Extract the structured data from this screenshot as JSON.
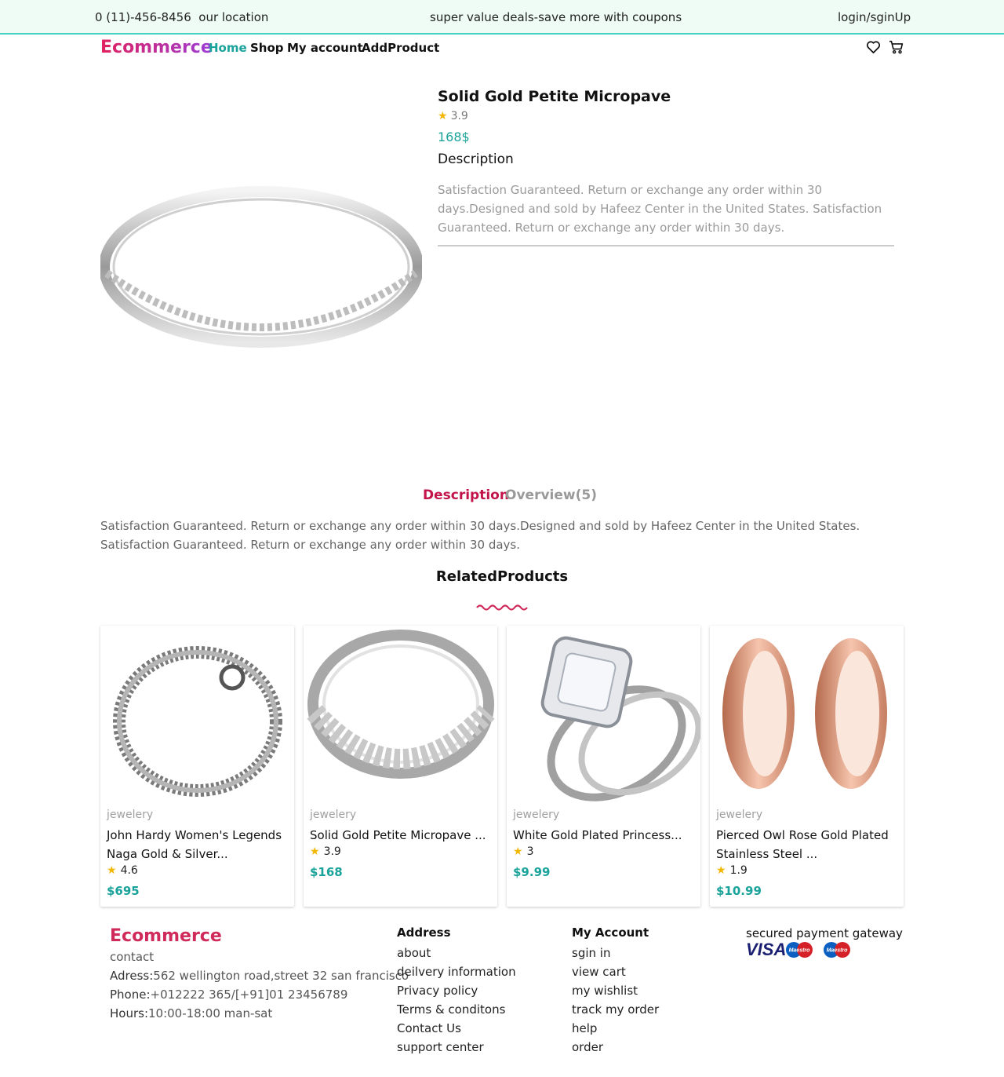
{
  "topbar": {
    "phone_location": "0 (11)-456-8456  our location",
    "deals": "super value deals-save more with coupons",
    "login": "login/sginUp"
  },
  "nav": {
    "brand": "Ecommerce",
    "links": [
      "Home",
      "Shop",
      "My account",
      "AddProduct"
    ],
    "icons": [
      "heart-icon",
      "cart-icon"
    ]
  },
  "product": {
    "title": "Solid Gold Petite Micropave",
    "rating": "3.9",
    "price": "168$",
    "description_heading": "Description",
    "description": "Satisfaction Guaranteed. Return or exchange any order within 30 days.Designed and sold by Hafeez Center in the United States. Satisfaction Guaranteed. Return or exchange any order within 30 days."
  },
  "tabs": {
    "items": [
      "Description",
      "Overview(5)"
    ],
    "active": "Description",
    "content": "Satisfaction Guaranteed. Return or exchange any order within 30 days.Designed and sold by Hafeez Center in the United States. Satisfaction Guaranteed. Return or exchange any order within 30 days."
  },
  "related": {
    "title": "RelatedProducts",
    "products": [
      {
        "category": "jewelery",
        "name": "John Hardy Women's Legends Naga Gold & Silver...",
        "rating": "4.6",
        "price": "$695"
      },
      {
        "category": "jewelery",
        "name": "Solid Gold Petite Micropave ...",
        "rating": "3.9",
        "price": "$168"
      },
      {
        "category": "jewelery",
        "name": "White Gold Plated Princess...",
        "rating": "3",
        "price": "$9.99"
      },
      {
        "category": "jewelery",
        "name": "Pierced Owl Rose Gold Plated Stainless Steel ...",
        "rating": "1.9",
        "price": "$10.99"
      }
    ]
  },
  "footer": {
    "brand": "Ecommerce",
    "contact": "contact",
    "address_label": "Adress:",
    "address": "562 wellington road,street 32 san francisco",
    "phone_label": "Phone:",
    "phone": "+012222 365/[+91]01 23456789",
    "hours_label": "Hours:",
    "hours": "10:00-18:00 man-sat",
    "col1": {
      "heading": "Address",
      "links": [
        "about",
        "deilvery information",
        "Privacy policy",
        "Terms & conditons",
        "Contact Us",
        "support center"
      ]
    },
    "col2": {
      "heading": "My Account",
      "links": [
        "sgin in",
        "view cart",
        "my wishlist",
        "track my order",
        "help",
        "order"
      ]
    },
    "secure": "secured payment gateway",
    "payment_logos": [
      "VISA",
      "Maestro",
      "Maestro"
    ]
  },
  "colors": {
    "accent_teal": "#1aa39a",
    "brand_pink": "#d02a5a",
    "tab_active": "#c2144a",
    "star": "#f2b705",
    "topbar_bg": "#eefcf5"
  }
}
